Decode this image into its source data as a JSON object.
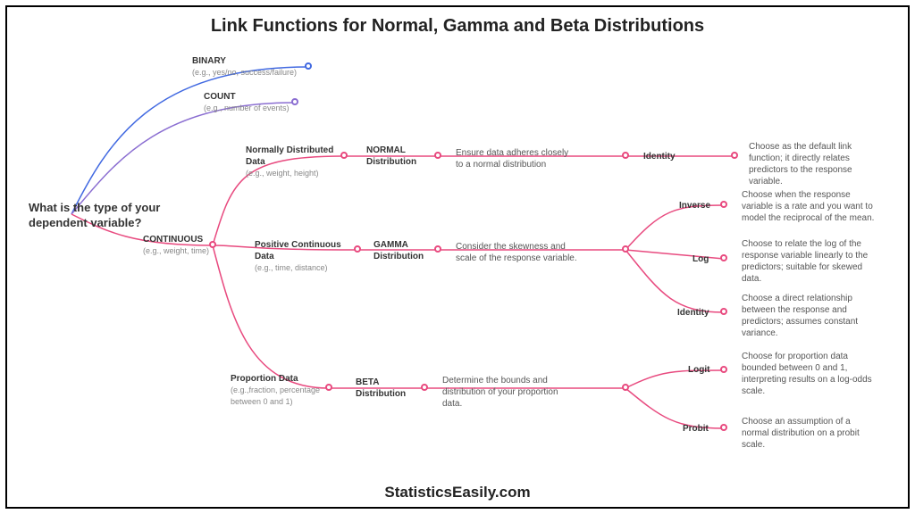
{
  "title": "Link Functions for Normal, Gamma and Beta Distributions",
  "footer": "StatisticsEasily.com",
  "root": "What is the type of your dependent variable?",
  "branches": {
    "binary": {
      "label": "BINARY",
      "sub": "(e.g., yes/no, success/failure)"
    },
    "count": {
      "label": "COUNT",
      "sub": "(e.g., number of events)"
    },
    "continuous": {
      "label": "CONTINUOUS",
      "sub": "(e.g., weight, time)"
    }
  },
  "normal": {
    "data": {
      "label": "Normally Distributed Data",
      "sub": "(e.g., weight, height)"
    },
    "dist": {
      "label": "NORMAL",
      "sub": "Distribution"
    },
    "note": "Ensure data adheres closely to a normal distribution",
    "link": {
      "label": "Identity",
      "desc": "Choose as the default link function; it directly relates predictors to the response variable."
    }
  },
  "gamma": {
    "data": {
      "label": "Positive Continuous Data",
      "sub": "(e.g., time, distance)"
    },
    "dist": {
      "label": "GAMMA",
      "sub": "Distribution"
    },
    "note": "Consider the skewness and scale of the response variable.",
    "links": {
      "inverse": {
        "label": "Inverse",
        "desc": "Choose when the response variable is a rate and you want to model the reciprocal of the mean."
      },
      "log": {
        "label": "Log",
        "desc": "Choose to relate the log of the response variable linearly to the predictors; suitable for skewed data."
      },
      "identity": {
        "label": "Identity",
        "desc": "Choose a direct relationship between the response and predictors; assumes constant variance."
      }
    }
  },
  "beta": {
    "data": {
      "label": "Proportion Data",
      "sub": "(e.g.,fraction, percentage between 0 and 1)"
    },
    "dist": {
      "label": "BETA",
      "sub": "Distribution"
    },
    "note": "Determine the bounds and distribution of your proportion data.",
    "links": {
      "logit": {
        "label": "Logit",
        "desc": "Choose for proportion data bounded between 0 and 1, interpreting results on a log-odds scale."
      },
      "probit": {
        "label": "Probit",
        "desc": "Choose an assumption of a normal distribution on a probit scale."
      }
    }
  }
}
